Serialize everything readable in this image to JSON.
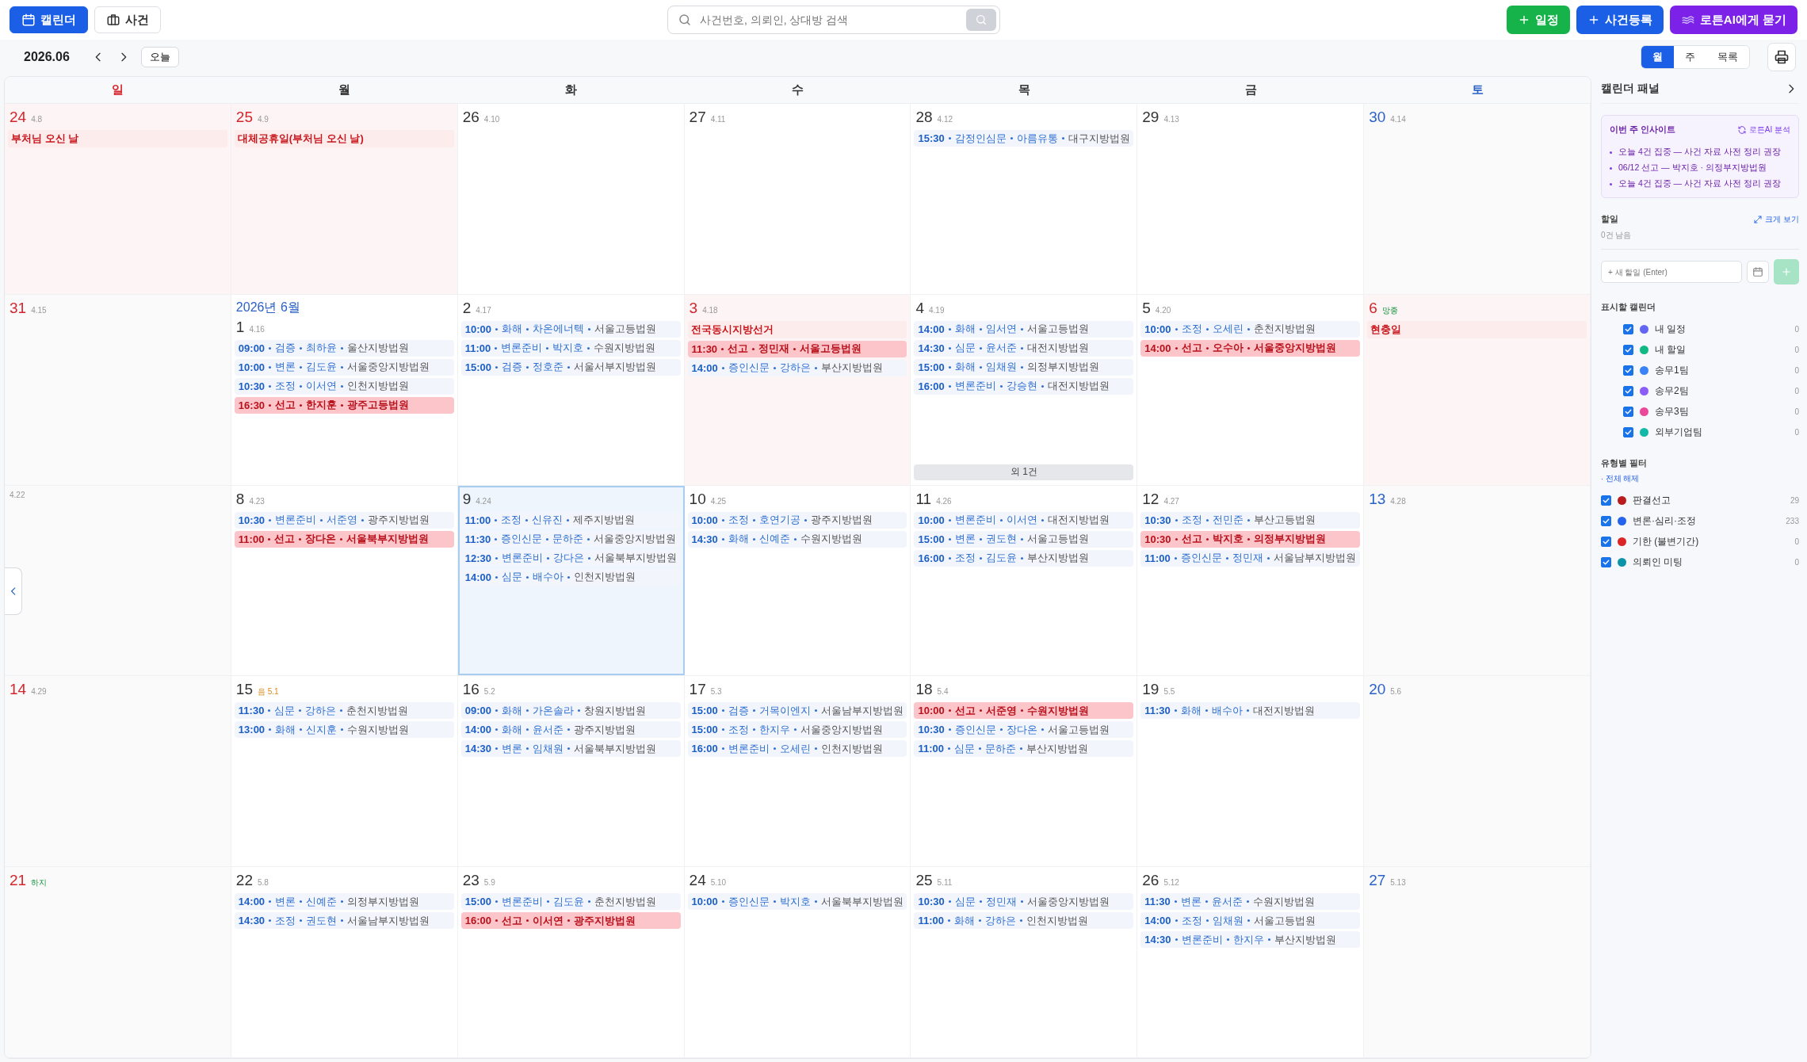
{
  "nav_tabs": [
    {
      "label": "캘린더",
      "selected": true
    },
    {
      "label": "사건",
      "selected": false
    }
  ],
  "search": {
    "placeholder": "사건번호, 의뢰인, 상대방 검색"
  },
  "actions": [
    {
      "label": "일정",
      "kind": "schedule"
    },
    {
      "label": "사건등록",
      "kind": "case"
    },
    {
      "label": "로튼AI에게 묻기",
      "kind": "ai"
    }
  ],
  "toolbar": {
    "month": "2026.06",
    "today": "오늘",
    "views": [
      {
        "label": "월",
        "selected": true
      },
      {
        "label": "주",
        "selected": false
      },
      {
        "label": "목록",
        "selected": false
      }
    ]
  },
  "calendar": {
    "weekdays": [
      {
        "label": "일",
        "kind": "sunday"
      },
      {
        "label": "월",
        "kind": "weekday"
      },
      {
        "label": "화",
        "kind": "weekday"
      },
      {
        "label": "수",
        "kind": "weekday"
      },
      {
        "label": "목",
        "kind": "weekday"
      },
      {
        "label": "금",
        "kind": "weekday"
      },
      {
        "label": "토",
        "kind": "saturday"
      }
    ],
    "weeks": [
      {
        "days": [
          {
            "day": "24",
            "kind": "sunday",
            "sub": {
              "text": "4.8",
              "kind": "lunar"
            },
            "holiday": "부처님 오신 날"
          },
          {
            "day": "25",
            "kind": "holiday",
            "sub": {
              "text": "4.9",
              "kind": "lunar"
            },
            "holiday": "대체공휴일(부처님 오신 날)"
          },
          {
            "day": "26",
            "kind": "weekday",
            "sub": {
              "text": "4.10",
              "kind": "lunar"
            }
          },
          {
            "day": "27",
            "kind": "weekday",
            "sub": {
              "text": "4.11",
              "kind": "lunar"
            }
          },
          {
            "day": "28",
            "kind": "weekday",
            "sub": {
              "text": "4.12",
              "kind": "lunar"
            },
            "events": [
              {
                "time": "15:30",
                "type": "감정인심문",
                "person": "아름유통",
                "court": "대구지방법원",
                "kind": "normal"
              }
            ]
          },
          {
            "day": "29",
            "kind": "weekday",
            "sub": {
              "text": "4.13",
              "kind": "lunar"
            }
          },
          {
            "day": "30",
            "kind": "saturday",
            "sub": {
              "text": "4.14",
              "kind": "lunar"
            }
          }
        ]
      },
      {
        "days": [
          {
            "day": "31",
            "kind": "sunday",
            "sub": {
              "text": "4.15",
              "kind": "lunar"
            }
          },
          {
            "day": "1",
            "kind": "weekday",
            "month_label": "2026년 6월",
            "sub": {
              "text": "4.16",
              "kind": "lunar"
            },
            "events": [
              {
                "time": "09:00",
                "type": "검증",
                "person": "최하윤",
                "court": "울산지방법원",
                "kind": "normal"
              },
              {
                "time": "10:00",
                "type": "변론",
                "person": "김도윤",
                "court": "서울중앙지방법원",
                "kind": "normal"
              },
              {
                "time": "10:30",
                "type": "조정",
                "person": "이서연",
                "court": "인천지방법원",
                "kind": "normal"
              },
              {
                "time": "16:30",
                "type": "선고",
                "person": "한지훈",
                "court": "광주고등법원",
                "kind": "verdict"
              }
            ]
          },
          {
            "day": "2",
            "kind": "weekday",
            "sub": {
              "text": "4.17",
              "kind": "lunar"
            },
            "events": [
              {
                "time": "10:00",
                "type": "화해",
                "person": "차온에너텍",
                "court": "서울고등법원",
                "kind": "normal"
              },
              {
                "time": "11:00",
                "type": "변론준비",
                "person": "박지호",
                "court": "수원지방법원",
                "kind": "normal"
              },
              {
                "time": "15:00",
                "type": "검증",
                "person": "정호준",
                "court": "서울서부지방법원",
                "kind": "normal"
              }
            ]
          },
          {
            "day": "3",
            "kind": "holiday",
            "sub": {
              "text": "4.18",
              "kind": "lunar"
            },
            "holiday": "전국동시지방선거",
            "events": [
              {
                "time": "11:30",
                "type": "선고",
                "person": "정민재",
                "court": "서울고등법원",
                "kind": "verdict"
              },
              {
                "time": "14:00",
                "type": "증인신문",
                "person": "강하은",
                "court": "부산지방법원",
                "kind": "normal"
              }
            ]
          },
          {
            "day": "4",
            "kind": "weekday",
            "sub": {
              "text": "4.19",
              "kind": "lunar"
            },
            "more": "외 1건",
            "events": [
              {
                "time": "14:00",
                "type": "화해",
                "person": "임서연",
                "court": "서울고등법원",
                "kind": "normal"
              },
              {
                "time": "14:30",
                "type": "심문",
                "person": "윤서준",
                "court": "대전지방법원",
                "kind": "normal"
              },
              {
                "time": "15:00",
                "type": "화해",
                "person": "임채원",
                "court": "의정부지방법원",
                "kind": "normal"
              },
              {
                "time": "16:00",
                "type": "변론준비",
                "person": "강승현",
                "court": "대전지방법원",
                "kind": "normal"
              }
            ]
          },
          {
            "day": "5",
            "kind": "weekday",
            "sub": {
              "text": "4.20",
              "kind": "lunar"
            },
            "events": [
              {
                "time": "10:00",
                "type": "조정",
                "person": "오세린",
                "court": "춘천지방법원",
                "kind": "normal"
              },
              {
                "time": "14:00",
                "type": "선고",
                "person": "오수아",
                "court": "서울중앙지방법원",
                "kind": "verdict"
              }
            ]
          },
          {
            "day": "6",
            "kind": "holiday",
            "sub": {
              "text": "망종",
              "kind": "term"
            },
            "holiday": "현충일"
          }
        ]
      },
      {
        "days": [
          {
            "sub": {
              "text": "4.22",
              "kind": "lunar"
            }
          },
          {
            "day": "8",
            "kind": "weekday",
            "sub": {
              "text": "4.23",
              "kind": "lunar"
            },
            "events": [
              {
                "time": "10:30",
                "type": "변론준비",
                "person": "서준영",
                "court": "광주지방법원",
                "kind": "normal"
              },
              {
                "time": "11:00",
                "type": "선고",
                "person": "장다온",
                "court": "서울북부지방법원",
                "kind": "verdict"
              }
            ]
          },
          {
            "day": "9",
            "kind": "weekday",
            "selected": true,
            "sub": {
              "text": "4.24",
              "kind": "lunar"
            },
            "events": [
              {
                "time": "11:00",
                "type": "조정",
                "person": "신유진",
                "court": "제주지방법원",
                "kind": "normal"
              },
              {
                "time": "11:30",
                "type": "증인신문",
                "person": "문하준",
                "court": "서울중앙지방법원",
                "kind": "normal"
              },
              {
                "time": "12:30",
                "type": "변론준비",
                "person": "강다은",
                "court": "서울북부지방법원",
                "kind": "normal"
              },
              {
                "time": "14:00",
                "type": "심문",
                "person": "배수아",
                "court": "인천지방법원",
                "kind": "normal"
              }
            ]
          },
          {
            "day": "10",
            "kind": "weekday",
            "sub": {
              "text": "4.25",
              "kind": "lunar"
            },
            "events": [
              {
                "time": "10:00",
                "type": "조정",
                "person": "호연기공",
                "court": "광주지방법원",
                "kind": "normal"
              },
              {
                "time": "14:30",
                "type": "화해",
                "person": "신예준",
                "court": "수원지방법원",
                "kind": "normal"
              }
            ]
          },
          {
            "day": "11",
            "kind": "weekday",
            "sub": {
              "text": "4.26",
              "kind": "lunar"
            },
            "events": [
              {
                "time": "10:00",
                "type": "변론준비",
                "person": "이서연",
                "court": "대전지방법원",
                "kind": "normal"
              },
              {
                "time": "15:00",
                "type": "변론",
                "person": "권도현",
                "court": "서울고등법원",
                "kind": "normal"
              },
              {
                "time": "16:00",
                "type": "조정",
                "person": "김도윤",
                "court": "부산지방법원",
                "kind": "normal"
              }
            ]
          },
          {
            "day": "12",
            "kind": "weekday",
            "sub": {
              "text": "4.27",
              "kind": "lunar"
            },
            "events": [
              {
                "time": "10:30",
                "type": "조정",
                "person": "전민준",
                "court": "부산고등법원",
                "kind": "normal"
              },
              {
                "time": "10:30",
                "type": "선고",
                "person": "박지호",
                "court": "의정부지방법원",
                "kind": "verdict"
              },
              {
                "time": "11:00",
                "type": "증인신문",
                "person": "정민재",
                "court": "서울남부지방법원",
                "kind": "normal"
              }
            ]
          },
          {
            "day": "13",
            "kind": "saturday",
            "sub": {
              "text": "4.28",
              "kind": "lunar"
            }
          }
        ]
      },
      {
        "days": [
          {
            "day": "14",
            "kind": "sunday",
            "sub": {
              "text": "4.29",
              "kind": "lunar"
            }
          },
          {
            "day": "15",
            "kind": "weekday",
            "sub": {
              "text": "음 5.1",
              "kind": "lunar_month"
            },
            "events": [
              {
                "time": "11:30",
                "type": "심문",
                "person": "강하은",
                "court": "춘천지방법원",
                "kind": "normal"
              },
              {
                "time": "13:00",
                "type": "화해",
                "person": "신지훈",
                "court": "수원지방법원",
                "kind": "normal"
              }
            ]
          },
          {
            "day": "16",
            "kind": "weekday",
            "sub": {
              "text": "5.2",
              "kind": "lunar"
            },
            "events": [
              {
                "time": "09:00",
                "type": "화해",
                "person": "가온솔라",
                "court": "창원지방법원",
                "kind": "normal"
              },
              {
                "time": "14:00",
                "type": "화해",
                "person": "윤서준",
                "court": "광주지방법원",
                "kind": "normal"
              },
              {
                "time": "14:30",
                "type": "변론",
                "person": "임채원",
                "court": "서울북부지방법원",
                "kind": "normal"
              }
            ]
          },
          {
            "day": "17",
            "kind": "weekday",
            "sub": {
              "text": "5.3",
              "kind": "lunar"
            },
            "events": [
              {
                "time": "15:00",
                "type": "검증",
                "person": "거목이엔지",
                "court": "서울남부지방법원",
                "kind": "normal"
              },
              {
                "time": "15:00",
                "type": "조정",
                "person": "한지우",
                "court": "서울중앙지방법원",
                "kind": "normal"
              },
              {
                "time": "16:00",
                "type": "변론준비",
                "person": "오세린",
                "court": "인천지방법원",
                "kind": "normal"
              }
            ]
          },
          {
            "day": "18",
            "kind": "weekday",
            "sub": {
              "text": "5.4",
              "kind": "lunar"
            },
            "events": [
              {
                "time": "10:00",
                "type": "선고",
                "person": "서준영",
                "court": "수원지방법원",
                "kind": "verdict"
              },
              {
                "time": "10:30",
                "type": "증인신문",
                "person": "장다온",
                "court": "서울고등법원",
                "kind": "normal"
              },
              {
                "time": "11:00",
                "type": "심문",
                "person": "문하준",
                "court": "부산지방법원",
                "kind": "normal"
              }
            ]
          },
          {
            "day": "19",
            "kind": "weekday",
            "sub": {
              "text": "5.5",
              "kind": "lunar"
            },
            "events": [
              {
                "time": "11:30",
                "type": "화해",
                "person": "배수아",
                "court": "대전지방법원",
                "kind": "normal"
              }
            ]
          },
          {
            "day": "20",
            "kind": "saturday",
            "sub": {
              "text": "5.6",
              "kind": "lunar"
            }
          }
        ]
      },
      {
        "days": [
          {
            "day": "21",
            "kind": "sunday",
            "sub": {
              "text": "하지",
              "kind": "term"
            }
          },
          {
            "day": "22",
            "kind": "weekday",
            "sub": {
              "text": "5.8",
              "kind": "lunar"
            },
            "events": [
              {
                "time": "14:00",
                "type": "변론",
                "person": "신예준",
                "court": "의정부지방법원",
                "kind": "normal"
              },
              {
                "time": "14:30",
                "type": "조정",
                "person": "권도현",
                "court": "서울남부지방법원",
                "kind": "normal"
              }
            ]
          },
          {
            "day": "23",
            "kind": "weekday",
            "sub": {
              "text": "5.9",
              "kind": "lunar"
            },
            "events": [
              {
                "time": "15:00",
                "type": "변론준비",
                "person": "김도윤",
                "court": "춘천지방법원",
                "kind": "normal"
              },
              {
                "time": "16:00",
                "type": "선고",
                "person": "이서연",
                "court": "광주지방법원",
                "kind": "verdict"
              }
            ]
          },
          {
            "day": "24",
            "kind": "weekday",
            "sub": {
              "text": "5.10",
              "kind": "lunar"
            },
            "events": [
              {
                "time": "10:00",
                "type": "증인신문",
                "person": "박지호",
                "court": "서울북부지방법원",
                "kind": "normal"
              }
            ]
          },
          {
            "day": "25",
            "kind": "weekday",
            "sub": {
              "text": "5.11",
              "kind": "lunar"
            },
            "events": [
              {
                "time": "10:30",
                "type": "심문",
                "person": "정민재",
                "court": "서울중앙지방법원",
                "kind": "normal"
              },
              {
                "time": "11:00",
                "type": "화해",
                "person": "강하은",
                "court": "인천지방법원",
                "kind": "normal"
              }
            ]
          },
          {
            "day": "26",
            "kind": "weekday",
            "sub": {
              "text": "5.12",
              "kind": "lunar"
            },
            "events": [
              {
                "time": "11:30",
                "type": "변론",
                "person": "윤서준",
                "court": "수원지방법원",
                "kind": "normal"
              },
              {
                "time": "14:00",
                "type": "조정",
                "person": "임채원",
                "court": "서울고등법원",
                "kind": "normal"
              },
              {
                "time": "14:30",
                "type": "변론준비",
                "person": "한지우",
                "court": "부산지방법원",
                "kind": "normal"
              }
            ]
          },
          {
            "day": "27",
            "kind": "saturday",
            "sub": {
              "text": "5.13",
              "kind": "lunar"
            }
          }
        ]
      }
    ]
  },
  "panel": {
    "title": "캘린더 패널",
    "insight": {
      "title": "이번 주 인사이트",
      "action": "로튼AI 분석",
      "items": [
        "오늘 4건 집중 — 사건 자료 사전 정리 권장",
        "06/12 선고 — 박지호 · 의정부지방법원",
        "오늘 4건 집중 — 사건 자료 사전 정리 권장"
      ]
    },
    "todo": {
      "title": "할일",
      "expand": "크게 보기",
      "remaining": "0건 남음",
      "placeholder": "+ 새 할일 (Enter)",
      "add_disabled": true
    },
    "calendars": {
      "title": "표시할 캘린더",
      "items": [
        {
          "label": "내 일정",
          "color": "#6366f1",
          "count": "0",
          "checked": true
        },
        {
          "label": "내 할일",
          "color": "#10b981",
          "count": "0",
          "checked": true
        },
        {
          "label": "송무1팀",
          "color": "#3b82f6",
          "count": "0",
          "checked": true
        },
        {
          "label": "송무2팀",
          "color": "#8b5cf6",
          "count": "0",
          "checked": true
        },
        {
          "label": "송무3팀",
          "color": "#ec4899",
          "count": "0",
          "checked": true
        },
        {
          "label": "외부기업팀",
          "color": "#14b8a6",
          "count": "0",
          "checked": true
        }
      ]
    },
    "filters": {
      "title": "유형별 필터",
      "clear": "· 전체 해제",
      "items": [
        {
          "label": "판결선고",
          "color": "#b91c1c",
          "count": "29",
          "checked": true
        },
        {
          "label": "변론·심리·조정",
          "color": "#2563eb",
          "count": "233",
          "checked": true
        },
        {
          "label": "기한 (불변기간)",
          "color": "#dc2626",
          "count": "0",
          "checked": true
        },
        {
          "label": "의뢰인 미팅",
          "color": "#0e94a8",
          "count": "0",
          "checked": true
        }
      ]
    }
  }
}
